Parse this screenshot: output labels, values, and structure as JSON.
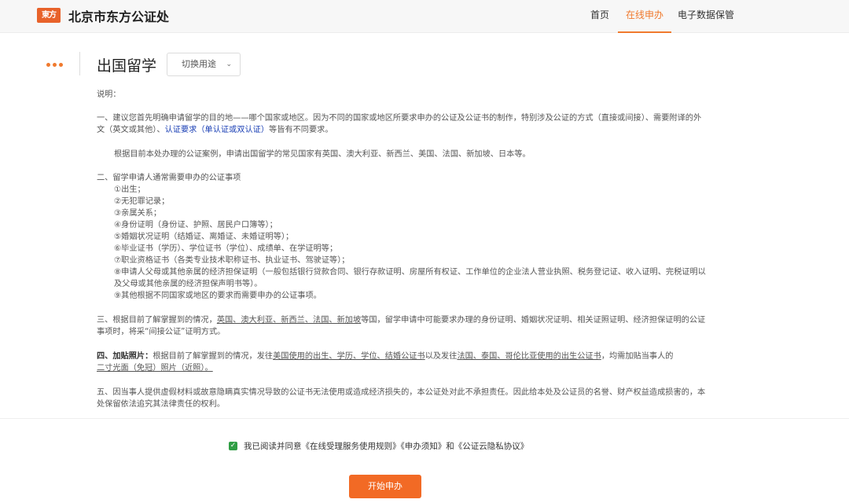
{
  "header": {
    "logo_text": "東方",
    "site_title": "北京市东方公证处",
    "nav": [
      {
        "label": "首页"
      },
      {
        "label": "在线申办"
      },
      {
        "label": "电子数据保管"
      }
    ]
  },
  "page": {
    "title": "出国留学",
    "purpose_select": "切换用途"
  },
  "content": {
    "intro": "说明：",
    "p1_line1": "一、建议您首先明确申请留学的目的地——哪个国家或地区。因为不同的国家或地区所要求申办的公证及公证书的制作，特别涉及公证的方式（直接或间接）、需要附译的外",
    "p1_line2_a": "文（英文或其他）、",
    "p1_line2_link": "认证要求（单认证或双认证）",
    "p1_line2_b": "等皆有不同要求。",
    "p2": "根据目前本处办理的公证案例，申请出国留学的常见国家有英国、澳大利亚、新西兰、美国、法国、新加坡、日本等。",
    "p3_head": "二、留学申请人通常需要申办的公证事项",
    "items": [
      "①出生；",
      "②无犯罪记录；",
      "③亲属关系；",
      "④身份证明（身份证、护照、居民户口簿等）；",
      "⑤婚姻状况证明（结婚证、离婚证、未婚证明等）；",
      "⑥毕业证书（学历）、学位证书（学位）、成绩单、在学证明等；",
      "⑦职业资格证书（各类专业技术职称证书、执业证书、驾驶证等）；",
      "⑧申请人父母或其他亲属的经济担保证明（一般包括银行贷款合同、银行存款证明、房屋所有权证、工作单位的企业法人营业执照、税务登记证、收入证明、完税证明以",
      "及父母或其他亲属的经济担保声明书等）。",
      "⑨其他根据不同国家或地区的要求而需要申办的公证事项。"
    ],
    "p4_a": "三、根据目前了解掌握到的情况，",
    "p4_u": "英国、澳大利亚、新西兰、法国、新加坡",
    "p4_b": "等国，留学申请中可能要求办理的身份证明、婚姻状况证明、相关证照证明、经济担保证明的公证",
    "p4_line2": "事项时，将采“间接公证”证明方式。",
    "p5_bold": "四、加贴照片：",
    "p5_a": "根据目前了解掌握到的情况，发往",
    "p5_u1": "美国使用的出生、学历、学位、结婚公证书",
    "p5_b": "以及发往",
    "p5_u2": "法国、泰国、哥伦比亚使用的出生公证书",
    "p5_c": "，均需加贴当事人的",
    "p5_line2": "二寸光面（免冠）照片（近照）。",
    "p6_line1": "五、因当事人提供虚假材料或故意隐瞒真实情况导致的公证书无法使用或造成经济损失的，本公证处对此不承担责任。因此给本处及公证员的名誉、财产权益造成损害的，本",
    "p6_line2": "处保留依法追究其法律责任的权利。"
  },
  "footer": {
    "agree_text": "我已阅读并同意《在线受理服务使用规则》《申办须知》和《公证云隐私协议》",
    "start_button": "开始申办"
  }
}
